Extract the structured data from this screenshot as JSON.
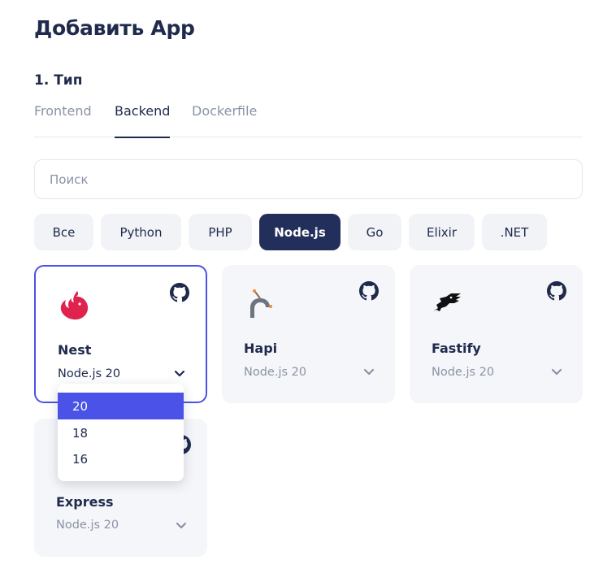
{
  "page": {
    "title": "Добавить App"
  },
  "section": {
    "title": "1. Тип"
  },
  "tabs": [
    {
      "label": "Frontend",
      "active": false
    },
    {
      "label": "Backend",
      "active": true
    },
    {
      "label": "Dockerfile",
      "active": false
    }
  ],
  "search": {
    "placeholder": "Поиск",
    "value": ""
  },
  "filters": [
    {
      "label": "Все",
      "active": false
    },
    {
      "label": "Python",
      "active": false
    },
    {
      "label": "PHP",
      "active": false
    },
    {
      "label": "Node.js",
      "active": true
    },
    {
      "label": "Go",
      "active": false
    },
    {
      "label": "Elixir",
      "active": false
    },
    {
      "label": ".NET",
      "active": false
    }
  ],
  "cards": [
    {
      "name": "Nest",
      "version": "Node.js 20",
      "logo_icon": "nestjs-logo",
      "link_icon": "github-icon",
      "selected": true
    },
    {
      "name": "Hapi",
      "version": "Node.js 20",
      "logo_icon": "hapi-logo",
      "link_icon": "github-icon",
      "selected": false
    },
    {
      "name": "Fastify",
      "version": "Node.js 20",
      "logo_icon": "fastify-logo",
      "link_icon": "github-icon",
      "selected": false
    },
    {
      "name": "Express",
      "version": "Node.js 20",
      "logo_icon": "express-logo",
      "link_icon": "github-icon",
      "selected": false
    }
  ],
  "version_dropdown": {
    "options": [
      "20",
      "18",
      "16"
    ],
    "selected": "20"
  },
  "colors": {
    "accent": "#4b52e8",
    "primary_dark": "#232f5b",
    "text": "#1f2a4d",
    "muted": "#8a93a6",
    "card_bg": "#f5f6f9",
    "chip_bg": "#f1f3f6",
    "nest_red": "#e0234e"
  }
}
